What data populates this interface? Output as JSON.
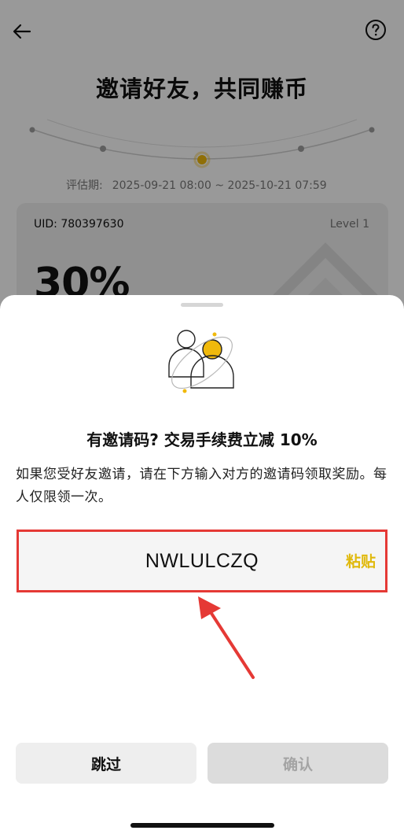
{
  "background": {
    "title": "邀请好友，共同赚币",
    "evaluation_label": "评估期:",
    "evaluation_period": "2025-09-21 08:00 ~ 2025-10-21 07:59",
    "uid": "UID: 780397630",
    "level": "Level 1",
    "rate": "30%"
  },
  "icons": {
    "back": "back-arrow-icon",
    "help": "help-circle-icon",
    "illustration": "invite-users-illustration",
    "annotation_arrow": "red-arrow-annotation"
  },
  "sheet": {
    "title": "有邀请码? 交易手续费立减 10%",
    "description": "如果您受好友邀请，请在下方输入对方的邀请码领取奖励。每人仅限领一次。",
    "code_value": "NWLULCZQ",
    "paste_label": "粘贴",
    "skip_label": "跳过",
    "confirm_label": "确认"
  },
  "colors": {
    "accent": "#F0B90B",
    "annotation": "#E53935",
    "button_secondary_bg": "#EEEEEE",
    "button_disabled_bg": "#DCDCDC"
  }
}
